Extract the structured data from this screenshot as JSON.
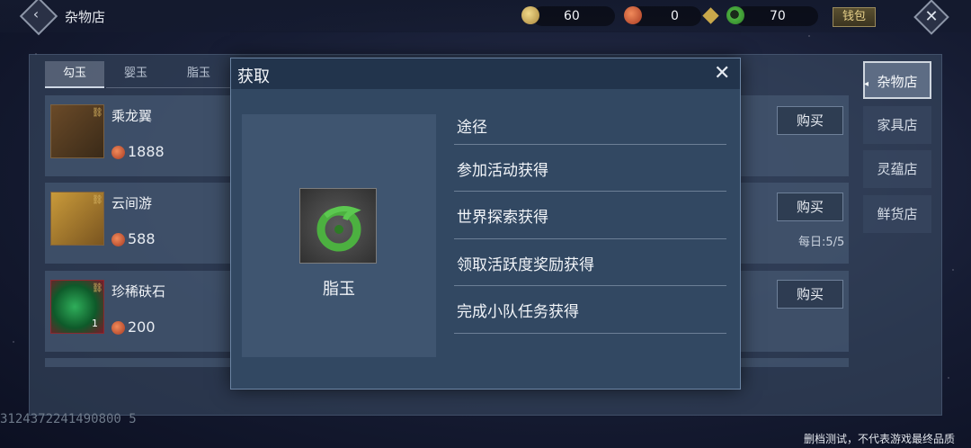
{
  "header": {
    "shop_title": "杂物店",
    "currencies": [
      {
        "icon": "gold-coin-icon",
        "value": "60"
      },
      {
        "icon": "red-coin-icon",
        "value": "0"
      },
      {
        "icon": "jade-icon",
        "value": "70"
      }
    ],
    "wallet_label": "钱包"
  },
  "tabs": [
    {
      "label": "勾玉",
      "active": true
    },
    {
      "label": "婴玉",
      "active": false
    },
    {
      "label": "脂玉",
      "active": false
    }
  ],
  "items": [
    {
      "name": "乘龙翼",
      "price": "1888",
      "qty": "",
      "buy": "购买"
    },
    {
      "name": "云间游",
      "price": "588",
      "qty": "",
      "buy": "购买",
      "limit": "每日:5/5"
    },
    {
      "name": "珍稀砆石",
      "price": "200",
      "qty": "1",
      "buy": "购买"
    }
  ],
  "side_nav": [
    {
      "label": "杂物店",
      "active": true
    },
    {
      "label": "家具店",
      "active": false
    },
    {
      "label": "灵蕴店",
      "active": false
    },
    {
      "label": "鲜货店",
      "active": false
    }
  ],
  "modal": {
    "title": "获取",
    "item_name": "脂玉",
    "route_header": "途径",
    "routes": [
      "参加活动获得",
      "世界探索获得",
      "领取活跃度奖励获得",
      "完成小队任务获得"
    ]
  },
  "footer": {
    "uid": "3124372241490800 5",
    "disclaimer": "删档测试，不代表游戏最终品质"
  },
  "colors": {
    "accent_gold": "#c9a84b",
    "jade_green": "#4cb040",
    "coin_red": "#c84a2a"
  }
}
